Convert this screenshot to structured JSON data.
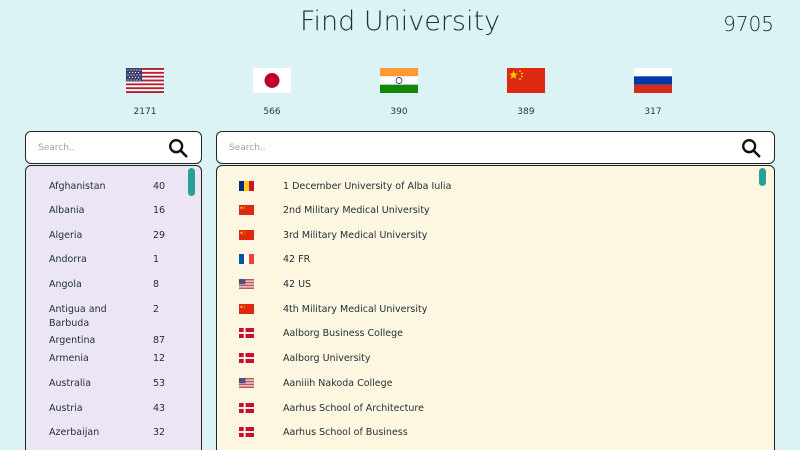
{
  "header": {
    "title": "Find University",
    "total": "9705"
  },
  "top_flags": [
    {
      "flag": "us-flag",
      "count": "2171"
    },
    {
      "flag": "jp-flag",
      "count": "566"
    },
    {
      "flag": "in-flag",
      "count": "390"
    },
    {
      "flag": "cn-flag",
      "count": "389"
    },
    {
      "flag": "ru-flag",
      "count": "317"
    }
  ],
  "country_search": {
    "placeholder": "Search..",
    "icon": "search-icon"
  },
  "university_search": {
    "placeholder": "Search..",
    "icon": "search-icon"
  },
  "countries": [
    {
      "name": "Afghanistan",
      "count": "40"
    },
    {
      "name": "Albania",
      "count": "16"
    },
    {
      "name": "Algeria",
      "count": "29"
    },
    {
      "name": "Andorra",
      "count": "1"
    },
    {
      "name": "Angola",
      "count": "8"
    },
    {
      "name": "Antigua and Barbuda",
      "count": "2"
    },
    {
      "name": "Argentina",
      "count": "87"
    },
    {
      "name": "Armenia",
      "count": "12"
    },
    {
      "name": "Australia",
      "count": "53"
    },
    {
      "name": "Austria",
      "count": "43"
    },
    {
      "name": "Azerbaijan",
      "count": "32"
    }
  ],
  "universities": [
    {
      "name": "1 December University of Alba Iulia",
      "flag": "ro-flag"
    },
    {
      "name": "2nd Military Medical University",
      "flag": "cn-flag"
    },
    {
      "name": "3rd Military Medical University",
      "flag": "cn-flag"
    },
    {
      "name": "42 FR",
      "flag": "fr-flag"
    },
    {
      "name": "42 US",
      "flag": "us-flag"
    },
    {
      "name": "4th Military Medical University",
      "flag": "cn-flag"
    },
    {
      "name": "Aalborg Business College",
      "flag": "dk-flag"
    },
    {
      "name": "Aalborg University",
      "flag": "dk-flag"
    },
    {
      "name": "Aaniiih Nakoda College",
      "flag": "us-flag"
    },
    {
      "name": "Aarhus School of Architecture",
      "flag": "dk-flag"
    },
    {
      "name": "Aarhus School of Business",
      "flag": "dk-flag"
    }
  ],
  "colors": {
    "background": "#dcf3f5",
    "country_panel": "#ece6f4",
    "university_panel": "#fdf6e1",
    "scrollbar": "#27a197"
  }
}
